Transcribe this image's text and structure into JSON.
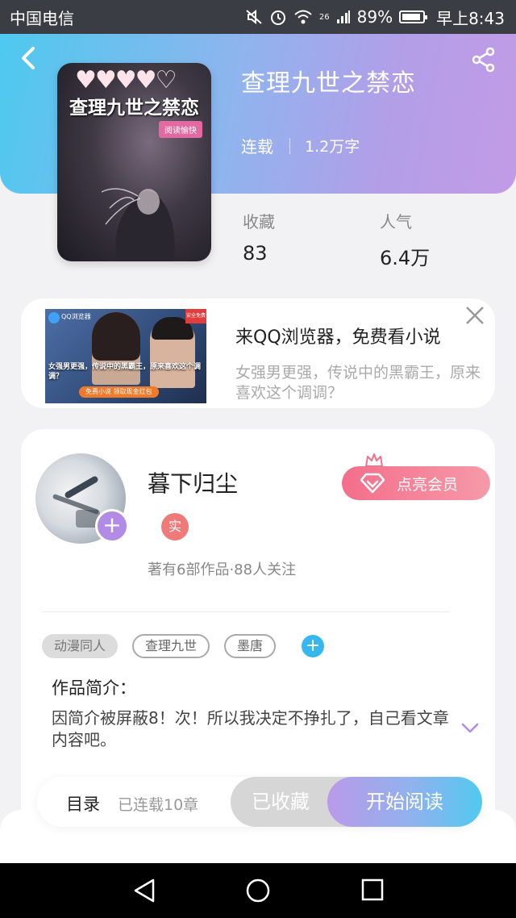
{
  "status_bar": {
    "carrier": "中国电信",
    "network": "26",
    "battery": "89%",
    "time": "早上8:43",
    "icons": [
      "mute-icon",
      "alarm-icon",
      "wifi-icon",
      "signal-icon",
      "battery-icon"
    ]
  },
  "header": {
    "back_icon": "chevron-left-icon",
    "share_icon": "share-icon",
    "title": "查理九世之禁恋",
    "status": "连载",
    "word_count": "1.2万字",
    "accent_start": "#4ec9ef",
    "accent_end": "#c39be6"
  },
  "cover": {
    "hearts": "♥♥♥♥♡",
    "title": "查理九世之禁恋",
    "tag": "阅读愉快"
  },
  "stats": {
    "favorites_label": "收藏",
    "favorites_value": "83",
    "popularity_label": "人气",
    "popularity_value": "6.4万"
  },
  "ad": {
    "title": "来QQ浏览器，免费看小说",
    "description": "女强男更强，传说中的黑霸王，原来喜欢这个调调？",
    "image_logo": "QQ浏览器",
    "image_corner": "安全免费",
    "image_caption": "女强男更强，传说中的黑霸王，原来喜欢这个调调？",
    "image_cta": "免费小说 领取现金红包",
    "close_icon": "close-icon"
  },
  "author": {
    "name": "暮下归尘",
    "verify_badge": "实",
    "stats": "著有6部作品·88人关注",
    "vip_button": "点亮会员",
    "add_icon": "plus-icon",
    "tags": [
      "动漫同人",
      "查理九世",
      "墨唐"
    ],
    "intro_label": "作品简介：",
    "intro_text": "因简介被屏蔽8！次！所以我决定不挣扎了，自己看文章内容吧。",
    "vip_color": "#f46e8a"
  },
  "action_bar": {
    "toc_label": "目录",
    "toc_count": "已连载10章",
    "collected_label": "已收藏",
    "start_label": "开始阅读"
  },
  "nav_bar": {
    "icons": [
      "nav-back-icon",
      "nav-home-icon",
      "nav-recent-icon"
    ]
  }
}
